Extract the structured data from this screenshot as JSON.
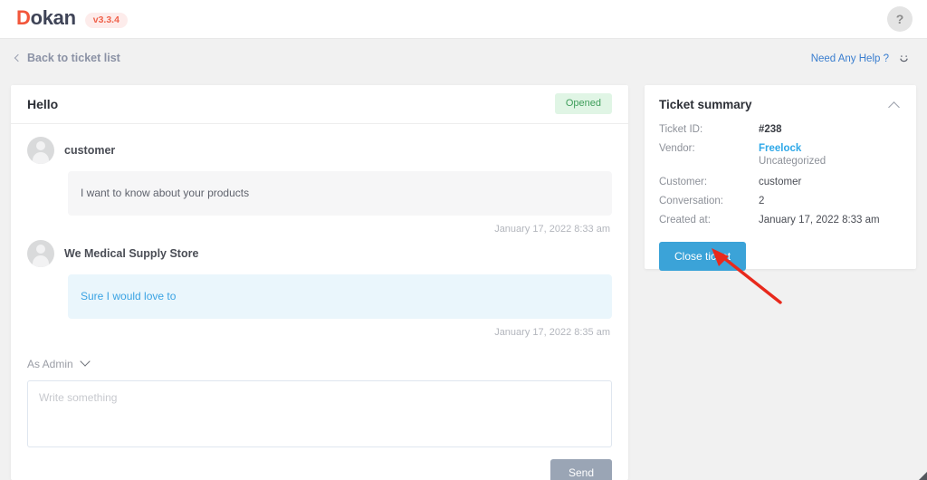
{
  "topbar": {
    "brand_first": "D",
    "brand_rest": "okan",
    "version": "v3.3.4",
    "help_icon": "question-mark-icon"
  },
  "subheader": {
    "back_label": "Back to ticket list",
    "back_icon": "chevron-left-icon",
    "need_help_label": "Need Any Help ?",
    "smiley_icon": "smiley-face-icon"
  },
  "ticket": {
    "title": "Hello",
    "status": "Opened",
    "messages": [
      {
        "author": "customer",
        "body": "I want to know about your products",
        "time": "January 17, 2022 8:33 am",
        "style": "grey"
      },
      {
        "author": "We Medical Supply Store",
        "body": "Sure I would love to",
        "time": "January 17, 2022 8:35 am",
        "style": "blue"
      }
    ],
    "reply": {
      "role_label": "As Admin",
      "role_icon": "chevron-down-icon",
      "placeholder": "Write something",
      "value": "",
      "send_label": "Send"
    }
  },
  "summary": {
    "title": "Ticket summary",
    "collapse_icon": "chevron-up-icon",
    "rows": [
      {
        "label": "Ticket ID:",
        "value": "#238"
      },
      {
        "label": "Vendor:",
        "value": "Freelock",
        "sub": "Uncategorized"
      },
      {
        "label": "Customer:",
        "value": "customer"
      },
      {
        "label": "Conversation:",
        "value": "2"
      },
      {
        "label": "Created at:",
        "value": "January 17, 2022 8:33 am"
      }
    ],
    "close_label": "Close ticket"
  },
  "annotation": {
    "arrow_color": "#e8291c",
    "arrow_target": "close-ticket-button"
  },
  "colors": {
    "brand": "#f2563b",
    "accent_blue": "#3ba3d8",
    "status_green": "#3f9e5b",
    "page_bg": "#f1f1f1"
  }
}
